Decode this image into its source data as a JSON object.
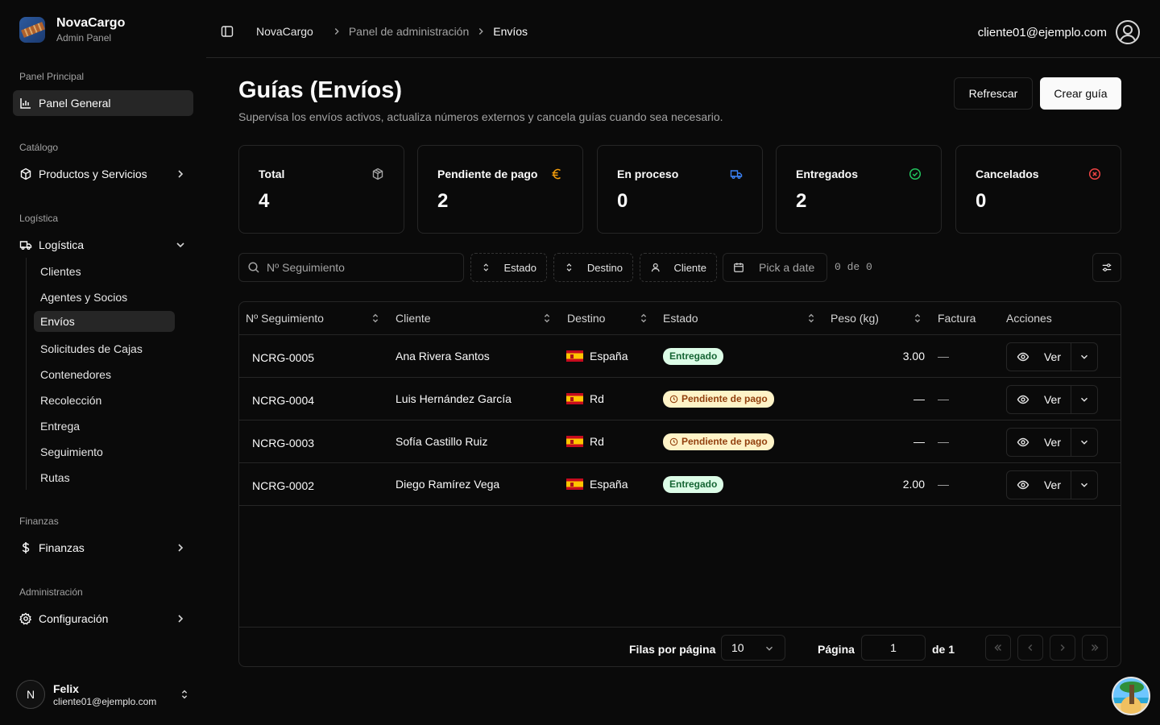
{
  "brand": {
    "name": "NovaCargo",
    "subtitle": "Admin Panel"
  },
  "sidebar": {
    "sections": {
      "principal": "Panel Principal",
      "catalogo": "Catálogo",
      "logistica": "Logística",
      "finanzas": "Finanzas",
      "admin": "Administración"
    },
    "items": {
      "panel_general": "Panel General",
      "productos": "Productos y Servicios",
      "logistica": "Logística",
      "finanzas": "Finanzas",
      "configuracion": "Configuración"
    },
    "logistica_sub": [
      "Clientes",
      "Agentes y Socios",
      "Envíos",
      "Solicitudes de Cajas",
      "Contenedores",
      "Recolección",
      "Entrega",
      "Seguimiento",
      "Rutas"
    ],
    "user": {
      "initial": "N",
      "name": "Felix",
      "email": "cliente01@ejemplo.com"
    }
  },
  "topbar": {
    "breadcrumb": [
      "NovaCargo",
      "Panel de administración",
      "Envíos"
    ],
    "user_email": "cliente01@ejemplo.com"
  },
  "page": {
    "title": "Guías (Envíos)",
    "subtitle": "Supervisa los envíos activos, actualiza números externos y cancela guías cuando sea necesario.",
    "refresh_label": "Refrescar",
    "create_label": "Crear guía"
  },
  "stats": [
    {
      "label": "Total",
      "value": "4",
      "icon": "box-icon",
      "color": "#a3a3a3"
    },
    {
      "label": "Pendiente de pago",
      "value": "2",
      "icon": "euro-icon",
      "color": "#f59e0b"
    },
    {
      "label": "En proceso",
      "value": "0",
      "icon": "truck-icon",
      "color": "#3b82f6"
    },
    {
      "label": "Entregados",
      "value": "2",
      "icon": "check-circle-icon",
      "color": "#22c55e"
    },
    {
      "label": "Cancelados",
      "value": "0",
      "icon": "x-circle-icon",
      "color": "#ef4444"
    }
  ],
  "filters": {
    "search_placeholder": "Nº Seguimiento",
    "estado": "Estado",
    "destino": "Destino",
    "cliente": "Cliente",
    "date": "Pick a date",
    "count": "0 de 0"
  },
  "table": {
    "headers": [
      "Nº Seguimiento",
      "Cliente",
      "Destino",
      "Estado",
      "Peso (kg)",
      "Factura",
      "Acciones"
    ],
    "rows": [
      {
        "tracking": "NCRG-0005",
        "client": "Ana Rivera Santos",
        "destination": "España",
        "status": "Entregado",
        "status_kind": "ok",
        "weight": "3.00",
        "invoice": "—",
        "action": "Ver"
      },
      {
        "tracking": "NCRG-0004",
        "client": "Luis Hernández García",
        "destination": "Rd",
        "status": "Pendiente de pago",
        "status_kind": "pend",
        "weight": "—",
        "invoice": "—",
        "action": "Ver"
      },
      {
        "tracking": "NCRG-0003",
        "client": "Sofía Castillo Ruiz",
        "destination": "Rd",
        "status": "Pendiente de pago",
        "status_kind": "pend",
        "weight": "—",
        "invoice": "—",
        "action": "Ver"
      },
      {
        "tracking": "NCRG-0002",
        "client": "Diego Ramírez Vega",
        "destination": "España",
        "status": "Entregado",
        "status_kind": "ok",
        "weight": "2.00",
        "invoice": "—",
        "action": "Ver"
      }
    ]
  },
  "pagination": {
    "rows_label": "Filas por página",
    "rows_value": "10",
    "page_label": "Página",
    "page_value": "1",
    "of_label": "de 1"
  }
}
